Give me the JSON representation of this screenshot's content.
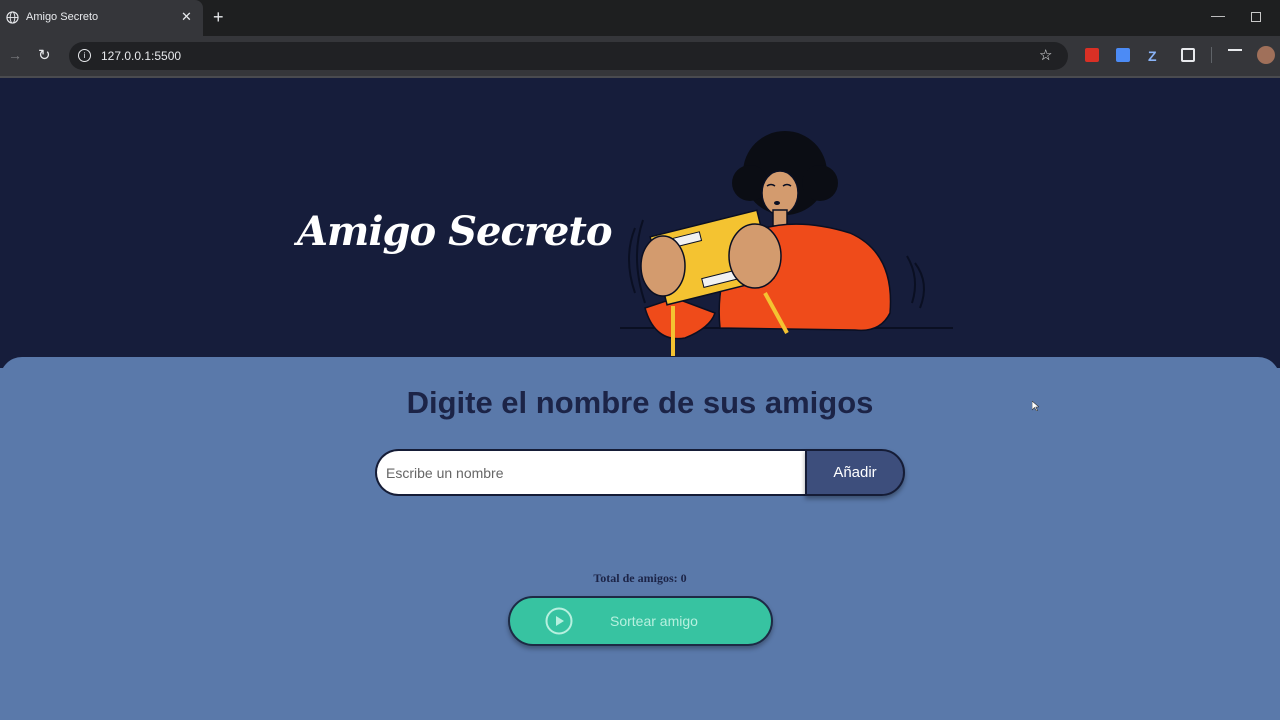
{
  "browser": {
    "tab_title": "Amigo Secreto",
    "tab_close": "✕",
    "new_tab": "+",
    "url": "127.0.0.1:5500"
  },
  "header": {
    "title": "Amigo Secreto",
    "illustration_icon": "person-holding-gift-illustration"
  },
  "main": {
    "heading": "Digite el nombre de sus amigos",
    "input_placeholder": "Escribe un nombre",
    "input_value": "",
    "add_label": "Añadir",
    "total_label": "Total de amigos: 0",
    "draw_label": "Sortear amigo",
    "draw_icon": "play-circle-icon"
  },
  "colors": {
    "header_bg": "#161d3b",
    "main_bg": "#5a79aa",
    "add_button": "#3d4e7c",
    "draw_button": "#37c3a1",
    "heading": "#1c2447"
  }
}
